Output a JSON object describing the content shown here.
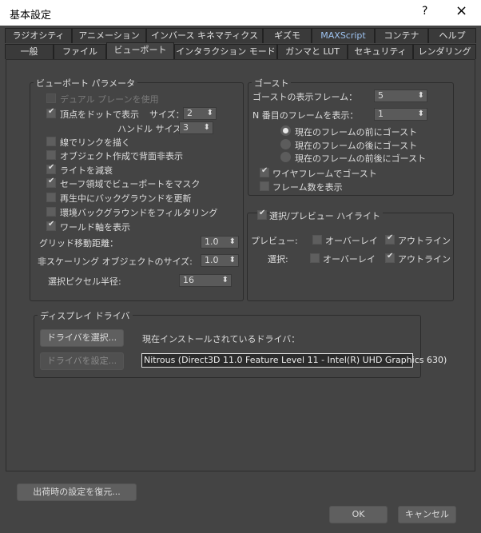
{
  "window": {
    "title": "基本設定",
    "help": "?",
    "close": "×"
  },
  "tabs_row1": [
    "ラジオシティ",
    "アニメーション",
    "インバース キネマティクス",
    "ギズモ",
    "MAXScript",
    "コンテナ",
    "ヘルプ"
  ],
  "tabs_row2": [
    "一般",
    "ファイル",
    "ビューポート",
    "インタラクション モード",
    "ガンマと LUT",
    "セキュリティ",
    "レンダリング"
  ],
  "active_tab": "ビューポート",
  "viewport_params": {
    "title": "ビューポート パラメータ",
    "dual_plane": "デュアル プレーンを使用",
    "vertex_dots": "頂点をドットで表示",
    "size_label": "サイズ：",
    "size_value": "2",
    "handle_size_label": "ハンドル サイズ：",
    "handle_size_value": "3",
    "draw_links": "線でリンクを描く",
    "backface_cull": "オブジェクト作成で背面非表示",
    "attenuate_lights": "ライトを減衰",
    "mask_safe": "セーフ領域でビューポートをマスク",
    "update_bg": "再生中にバックグラウンドを更新",
    "filter_bg": "環境バックグラウンドをフィルタリング",
    "world_axis": "ワールド軸を表示",
    "grid_nudge_label": "グリッド移動距離：",
    "grid_nudge_value": "1.0",
    "nonscale_label": "非スケーリング オブジェクトのサイズ:",
    "nonscale_value": "1.0",
    "pick_radius_label": "選択ピクセル半径:",
    "pick_radius_value": "16"
  },
  "ghosting": {
    "title": "ゴースト",
    "frames_label": "ゴーストの表示フレーム：",
    "frames_value": "5",
    "nth_label": "N 番目のフレームを表示：",
    "nth_value": "1",
    "radio": [
      "現在のフレームの前にゴースト",
      "現在のフレームの後にゴースト",
      "現在のフレームの前後にゴースト"
    ],
    "wireframe": "ワイヤフレームでゴースト",
    "show_frame_num": "フレーム数を表示"
  },
  "highlight": {
    "title": "選択/プレビュー ハイライト",
    "preview_label": "プレビュー:",
    "select_label": "選択:",
    "overlay": "オーバーレイ",
    "outline": "アウトライン"
  },
  "display_driver": {
    "title": "ディスプレイ ドライバ",
    "choose": "ドライバを選択...",
    "configure": "ドライバを設定...",
    "installed_label": "現在インストールされているドライバ：",
    "installed_value": "Nitrous (Direct3D 11.0 Feature Level 11 - Intel(R) UHD Graphics 630)"
  },
  "buttons": {
    "revert": "出荷時の設定を復元...",
    "ok": "OK",
    "cancel": "キャンセル"
  }
}
